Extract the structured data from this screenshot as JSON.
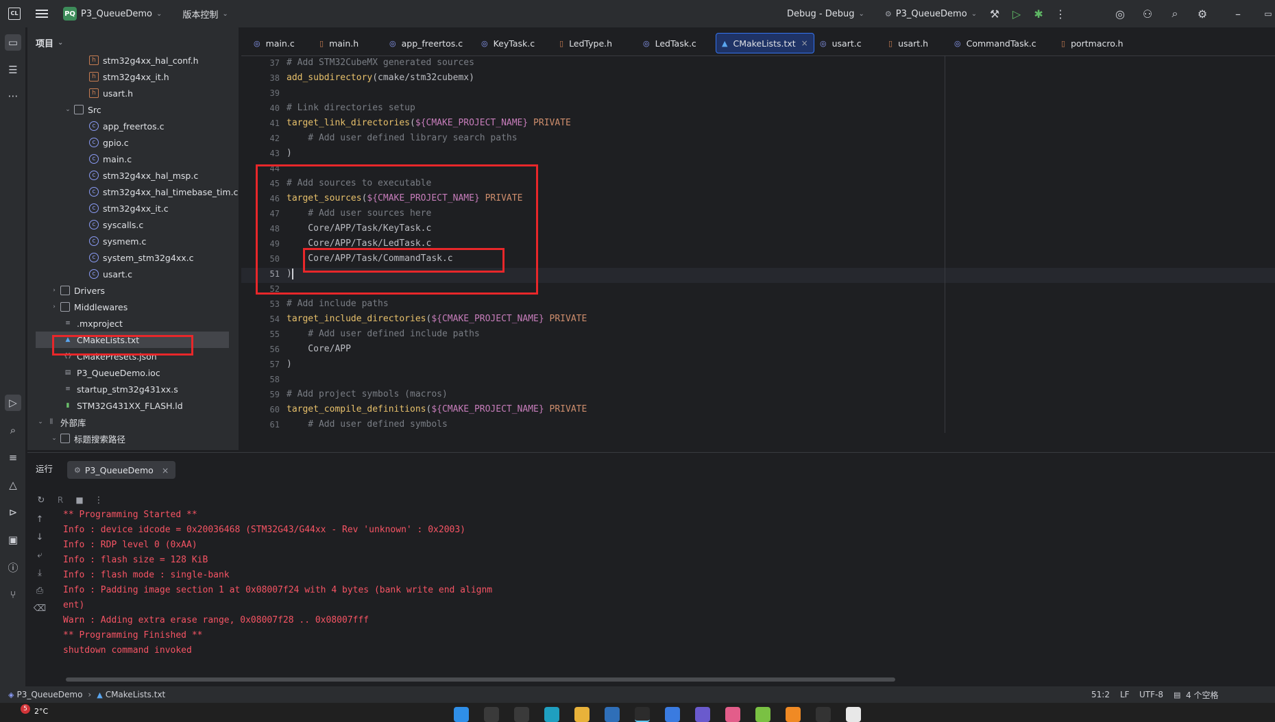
{
  "titlebar": {
    "project_badge": "PQ",
    "project_name": "P3_QueueDemo",
    "vcs": "版本控制",
    "run_config": "Debug - Debug",
    "target": "P3_QueueDemo"
  },
  "project_panel": {
    "title": "项目",
    "items": [
      {
        "label": "stm32g4xx_hal_conf.h",
        "type": "h"
      },
      {
        "label": "stm32g4xx_it.h",
        "type": "h"
      },
      {
        "label": "usart.h",
        "type": "h"
      },
      {
        "label": "Src",
        "type": "folder"
      },
      {
        "label": "app_freertos.c",
        "type": "c"
      },
      {
        "label": "gpio.c",
        "type": "c"
      },
      {
        "label": "main.c",
        "type": "c"
      },
      {
        "label": "stm32g4xx_hal_msp.c",
        "type": "c"
      },
      {
        "label": "stm32g4xx_hal_timebase_tim.c",
        "type": "c"
      },
      {
        "label": "stm32g4xx_it.c",
        "type": "c"
      },
      {
        "label": "syscalls.c",
        "type": "c"
      },
      {
        "label": "sysmem.c",
        "type": "c"
      },
      {
        "label": "system_stm32g4xx.c",
        "type": "c"
      },
      {
        "label": "usart.c",
        "type": "c"
      },
      {
        "label": "Drivers",
        "type": "folder"
      },
      {
        "label": "Middlewares",
        "type": "folder"
      },
      {
        "label": ".mxproject",
        "type": "txt"
      },
      {
        "label": "CMakeLists.txt",
        "type": "cmake"
      },
      {
        "label": "CMakePresets.json",
        "type": "json"
      },
      {
        "label": "P3_QueueDemo.ioc",
        "type": "ioc"
      },
      {
        "label": "startup_stm32g431xx.s",
        "type": "txt"
      },
      {
        "label": "STM32G431XX_FLASH.ld",
        "type": "ld"
      },
      {
        "label": "外部库",
        "type": "lib"
      },
      {
        "label": "标题搜索路径",
        "type": "folder"
      }
    ]
  },
  "tabs": [
    {
      "label": "main.c"
    },
    {
      "label": "main.h"
    },
    {
      "label": "app_freertos.c"
    },
    {
      "label": "KeyTask.c"
    },
    {
      "label": "LedType.h"
    },
    {
      "label": "LedTask.c"
    },
    {
      "label": "CMakeLists.txt"
    },
    {
      "label": "usart.c"
    },
    {
      "label": "usart.h"
    },
    {
      "label": "CommandTask.c"
    },
    {
      "label": "portmacro.h"
    }
  ],
  "editor": {
    "line_numbers": [
      "37",
      "38",
      "39",
      "40",
      "41",
      "42",
      "43",
      "44",
      "45",
      "46",
      "47",
      "48",
      "49",
      "50",
      "51",
      "52",
      "53",
      "54",
      "55",
      "56",
      "57",
      "58",
      "59",
      "60",
      "61"
    ],
    "lines": {
      "l37": "# Add STM32CubeMX generated sources",
      "l38_fn": "add_subdirectory",
      "l38_rest": "(cmake/stm32cubemx)",
      "l40": "# Link directories setup",
      "l41_fn": "target_link_directories",
      "l41_var": "${CMAKE_PROJECT_NAME}",
      "l41_kw": "PRIVATE",
      "l42": "    # Add user defined library search paths",
      "l43": ")",
      "l45": "# Add sources to executable",
      "l46_fn": "target_sources",
      "l46_var": "${CMAKE_PROJECT_NAME}",
      "l46_kw": "PRIVATE",
      "l47": "    # Add user sources here",
      "l48": "    Core/APP/Task/KeyTask.c",
      "l49": "    Core/APP/Task/LedTask.c",
      "l50": "    Core/APP/Task/CommandTask.c",
      "l51": ")",
      "l53": "# Add include paths",
      "l54_fn": "target_include_directories",
      "l54_var": "${CMAKE_PROJECT_NAME}",
      "l54_kw": "PRIVATE",
      "l55": "    # Add user defined include paths",
      "l56": "    Core/APP",
      "l57": ")",
      "l59": "# Add project symbols (macros)",
      "l60_fn": "target_compile_definitions",
      "l60_var": "${CMAKE_PROJECT_NAME}",
      "l60_kw": "PRIVATE",
      "l61": "    # Add user defined symbols"
    }
  },
  "run_panel": {
    "title": "运行",
    "tab": "P3_QueueDemo",
    "console": [
      "** Programming Started **",
      "Info : device idcode = 0x20036468 (STM32G43/G44xx - Rev 'unknown' : 0x2003)",
      "Info : RDP level 0 (0xAA)",
      "Info : flash size = 128 KiB",
      "Info : flash mode : single-bank",
      "Info : Padding image section 1 at 0x08007f24 with 4 bytes (bank write end alignm",
      "ent)",
      "Warn : Adding extra erase range, 0x08007f28 .. 0x08007fff",
      "** Programming Finished **",
      "shutdown command invoked"
    ]
  },
  "statusbar": {
    "crumb_project": "P3_QueueDemo",
    "crumb_file": "CMakeLists.txt",
    "position": "51:2",
    "line_sep": "LF",
    "encoding": "UTF-8",
    "indent": "4 个空格"
  },
  "taskbar": {
    "weather_badge": "5",
    "weather": "2°C"
  },
  "colors": {
    "accent": "#3574f0",
    "highlight_box": "#e8272a",
    "console_text": "#f75464"
  }
}
